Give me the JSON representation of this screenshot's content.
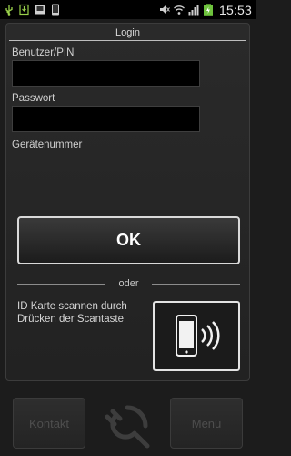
{
  "status_bar": {
    "time": "15:53",
    "icons": [
      "usb-icon",
      "download-icon",
      "gallery-icon",
      "phone-icon",
      "mute-icon",
      "wifi-icon",
      "signal-icon",
      "battery-icon"
    ]
  },
  "login": {
    "title": "Login",
    "username_label": "Benutzer/PIN",
    "username_value": "",
    "password_label": "Passwort",
    "password_value": "",
    "device_number_label": "Gerätenummer",
    "ok_label": "OK",
    "divider_label": "oder",
    "scan_hint": "ID Karte scannen durch Drücken der Scantaste"
  },
  "bottom_nav": {
    "contact_label": "Kontakt",
    "menu_label": "Menü"
  },
  "colors": {
    "background": "#1c1c1c",
    "panel": "#262626",
    "input": "#000000",
    "border_light": "#d9d9d9",
    "battery": "#6ec33d",
    "muted_text": "#4e4e4e"
  }
}
